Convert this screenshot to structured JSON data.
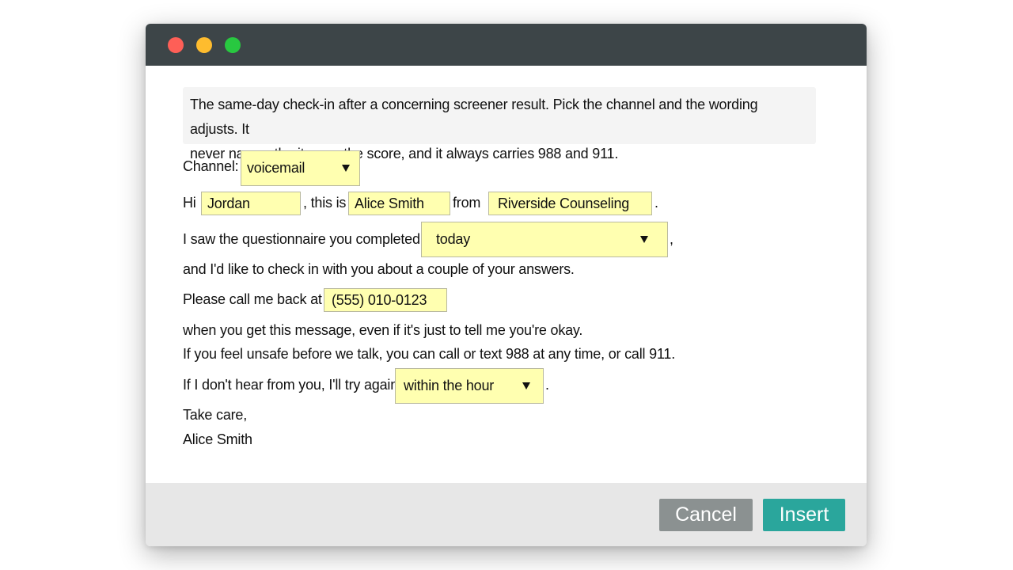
{
  "intro": {
    "line1": "The same-day check-in after a concerning screener result. Pick the channel and the wording adjusts. It",
    "line2": "never names the item or the score, and it always carries 988 and 911."
  },
  "channel": {
    "label": "Channel:",
    "value": "voicemail"
  },
  "greeting": {
    "hi": "Hi",
    "client_name": "Jordan",
    "this_is": ", this is",
    "clinician_name": "Alice Smith",
    "from": "from",
    "practice": "Riverside Counseling",
    "end": "."
  },
  "questionnaire": {
    "text": "I saw the questionnaire you completed",
    "when": "today",
    "end": ","
  },
  "check_in": "and I'd like to check in with you about a couple of your answers.",
  "callback": {
    "text": "Please call me back at",
    "phone": "(555) 010-0123"
  },
  "message_line": "when you get this message, even if it's just to tell me you're okay.",
  "safety_line": "If you feel unsafe before we talk, you can call or text 988 at any time, or call 911.",
  "retry": {
    "text": "If I don't hear from you, I'll try again",
    "when": "within the hour",
    "end": "."
  },
  "closing": "Take care,",
  "signature": "Alice Smith",
  "buttons": {
    "cancel": "Cancel",
    "insert": "Insert"
  },
  "colors": {
    "titlebar": "#3d4548",
    "field_bg": "#ffffb0",
    "cancel": "#8b9191",
    "insert": "#2aa69c"
  }
}
